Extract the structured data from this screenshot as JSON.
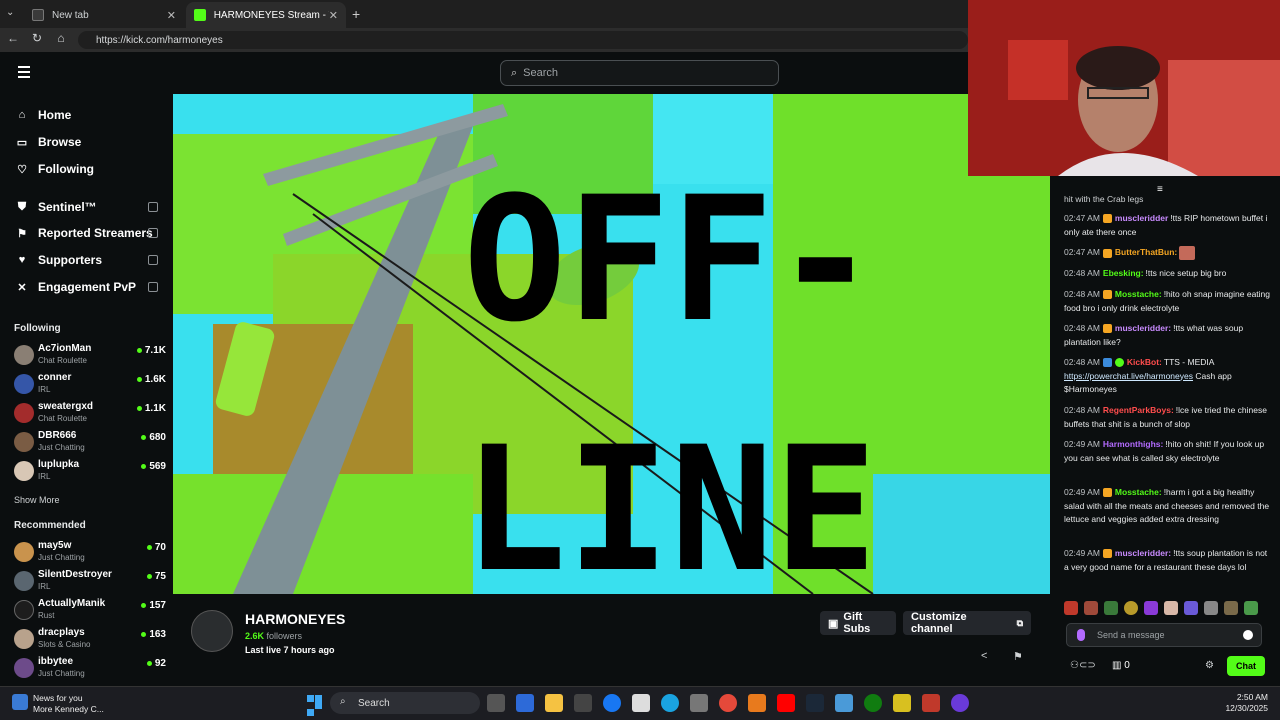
{
  "browser": {
    "tabs": [
      {
        "label": "New tab",
        "active": false
      },
      {
        "label": "HARMONEYES Stream - Watch Li",
        "active": true
      }
    ],
    "url": "https://kick.com/harmoneyes"
  },
  "header": {
    "search_placeholder": "Search"
  },
  "sidebar": {
    "nav": [
      {
        "label": "Home",
        "icon": "home-icon"
      },
      {
        "label": "Browse",
        "icon": "browse-icon"
      },
      {
        "label": "Following",
        "icon": "heart-icon"
      },
      {
        "label": "Sentinel™",
        "icon": "shield-icon"
      },
      {
        "label": "Reported Streamers",
        "icon": "flag-icon"
      },
      {
        "label": "Supporters",
        "icon": "heart-icon"
      },
      {
        "label": "Engagement PvP",
        "icon": "swords-icon"
      }
    ],
    "following_title": "Following",
    "following": [
      {
        "name": "Ac7ionMan",
        "category": "Chat Roulette",
        "viewers": "7.1K"
      },
      {
        "name": "conner",
        "category": "IRL",
        "viewers": "1.6K"
      },
      {
        "name": "sweatergxd",
        "category": "Chat Roulette",
        "viewers": "1.1K"
      },
      {
        "name": "DBR666",
        "category": "Just Chatting",
        "viewers": "680"
      },
      {
        "name": "luplupka",
        "category": "IRL",
        "viewers": "569"
      }
    ],
    "show_more": "Show More",
    "recommended_title": "Recommended",
    "recommended": [
      {
        "name": "may5w",
        "category": "Just Chatting",
        "viewers": "70"
      },
      {
        "name": "SilentDestroyer",
        "category": "IRL",
        "viewers": "75"
      },
      {
        "name": "ActuallyManik",
        "category": "Rust",
        "viewers": "157"
      },
      {
        "name": "dracplays",
        "category": "Slots & Casino",
        "viewers": "163"
      },
      {
        "name": "ibbytee",
        "category": "Just Chatting",
        "viewers": "92"
      }
    ]
  },
  "banner": {
    "line1": "OFF-",
    "line2": "LINE"
  },
  "channel": {
    "name": "HARMONEYES",
    "followers_count": "2.6K",
    "followers_label": "followers",
    "last_live": "Last live 7 hours ago",
    "gift_subs": "Gift Subs",
    "customize": "Customize channel"
  },
  "chat": {
    "partial_top": "hit with the Crab legs",
    "messages": [
      {
        "time": "02:47 AM",
        "user": "muscleridder",
        "color": "#c98bff",
        "text": "!tts RIP hometown buffet i only ate there once"
      },
      {
        "time": "02:47 AM",
        "user": "ButterThatBun:",
        "color": "#f5a623",
        "text": ""
      },
      {
        "time": "02:48 AM",
        "user": "Ebesking:",
        "color": "#53fc18",
        "text": "!tts nice setup big bro"
      },
      {
        "time": "02:48 AM",
        "user": "Mosstache:",
        "color": "#53fc18",
        "text": "!hito oh snap imagine eating food bro i only drink electrolyte"
      },
      {
        "time": "02:48 AM",
        "user": "muscleridder:",
        "color": "#c98bff",
        "text": "!tts what was soup plantation like?"
      },
      {
        "time": "02:48 AM",
        "user": "KickBot:",
        "color": "#ff4d4d",
        "text": "TTS - MEDIA",
        "link": "https://powerchat.live/harmoneyes",
        "after": "Cash app $Harmoneyes"
      },
      {
        "time": "02:48 AM",
        "user": "RegentParkBoys:",
        "color": "#ff4d4d",
        "text": "!lce ive tried the chinese buffets that shit is a bunch of slop"
      },
      {
        "time": "02:49 AM",
        "user": "Harmonthighs:",
        "color": "#b36bff",
        "text": "!hito oh shit! If you look up you can see what is called sky electrolyte"
      },
      {
        "time": "02:49 AM",
        "user": "Mosstache:",
        "color": "#53fc18",
        "text": "!harm i got a big healthy salad with all the meats and cheeses and removed the lettuce and veggies added extra dressing"
      },
      {
        "time": "02:49 AM",
        "user": "muscleridder:",
        "color": "#c98bff",
        "text": "!tts soup plantation is not a very good name for a restaurant these days lol"
      }
    ],
    "input_placeholder": "Send a message",
    "points": "0",
    "chat_button": "Chat"
  },
  "taskbar": {
    "news_title": "News for you",
    "news_sub": "More Kennedy C...",
    "search": "Search",
    "time": "2:50 AM",
    "date": "12/30/2025"
  }
}
